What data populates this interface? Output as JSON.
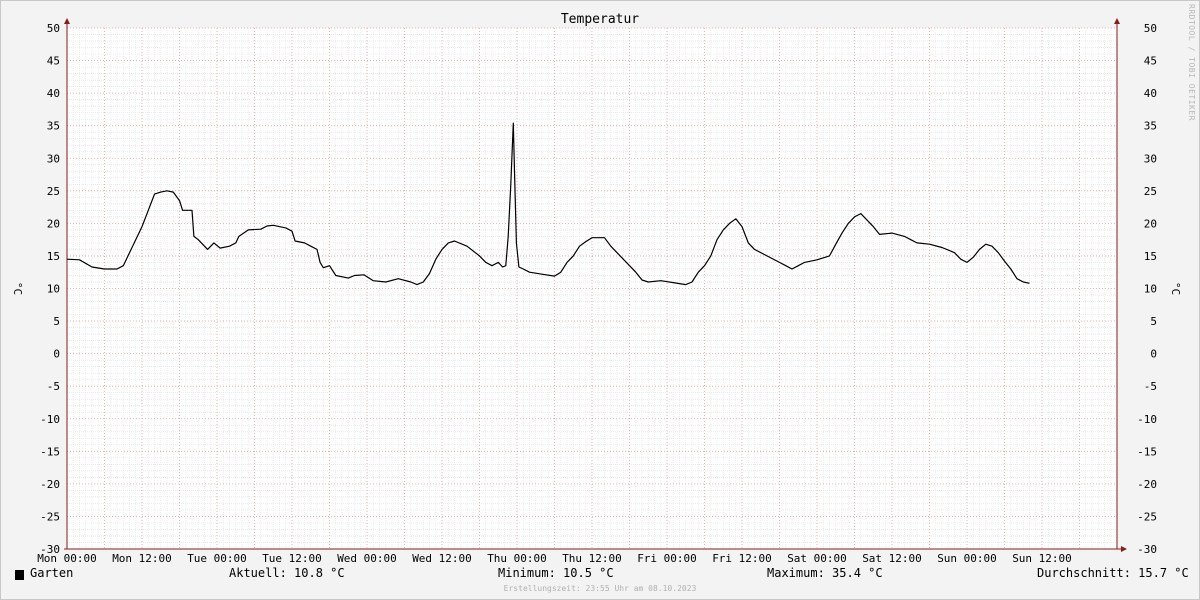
{
  "chart_data": {
    "type": "line",
    "title": "Temperatur",
    "ylabel": "°C",
    "ylabel_right": "°C",
    "ylim": [
      -30,
      50
    ],
    "y_ticks": [
      50,
      45,
      40,
      35,
      30,
      25,
      20,
      15,
      10,
      5,
      0,
      -5,
      -10,
      -15,
      -20,
      -25,
      -30
    ],
    "x_unit": "hours since Mon 00:00",
    "xlim": [
      0,
      168
    ],
    "x_tick_labels": [
      "Mon 00:00",
      "Mon 12:00",
      "Tue 00:00",
      "Tue 12:00",
      "Wed 00:00",
      "Wed 12:00",
      "Thu 00:00",
      "Thu 12:00",
      "Fri 00:00",
      "Fri 12:00",
      "Sat 00:00",
      "Sat 12:00",
      "Sun 00:00",
      "Sun 12:00"
    ],
    "x_tick_positions": [
      0,
      12,
      24,
      36,
      48,
      60,
      72,
      84,
      96,
      108,
      120,
      132,
      144,
      156
    ],
    "grid": true,
    "series": [
      {
        "name": "Garten",
        "color": "#000000",
        "points": [
          [
            0,
            14.5
          ],
          [
            2,
            14.4
          ],
          [
            4,
            13.3
          ],
          [
            6,
            13.0
          ],
          [
            8,
            13.0
          ],
          [
            9,
            13.5
          ],
          [
            10,
            15.5
          ],
          [
            12,
            19.5
          ],
          [
            13,
            22.0
          ],
          [
            14,
            24.5
          ],
          [
            15,
            24.8
          ],
          [
            16,
            25.0
          ],
          [
            17,
            24.8
          ],
          [
            18,
            23.5
          ],
          [
            18.5,
            22.0
          ],
          [
            20,
            22.0
          ],
          [
            20.3,
            18.0
          ],
          [
            21,
            17.5
          ],
          [
            22,
            16.5
          ],
          [
            22.5,
            16.0
          ],
          [
            23.5,
            17.0
          ],
          [
            24.5,
            16.2
          ],
          [
            26,
            16.5
          ],
          [
            27,
            17.0
          ],
          [
            27.5,
            18.0
          ],
          [
            29,
            19.0
          ],
          [
            31,
            19.1
          ],
          [
            32,
            19.6
          ],
          [
            33,
            19.7
          ],
          [
            35,
            19.3
          ],
          [
            36,
            18.8
          ],
          [
            36.5,
            17.3
          ],
          [
            38,
            17.0
          ],
          [
            39,
            16.5
          ],
          [
            40,
            16.0
          ],
          [
            40.5,
            14.0
          ],
          [
            41,
            13.2
          ],
          [
            42,
            13.5
          ],
          [
            43,
            12.0
          ],
          [
            45,
            11.6
          ],
          [
            46,
            12.0
          ],
          [
            47.5,
            12.1
          ],
          [
            49,
            11.2
          ],
          [
            51,
            11.0
          ],
          [
            53,
            11.5
          ],
          [
            55,
            11.0
          ],
          [
            56,
            10.6
          ],
          [
            57,
            11.0
          ],
          [
            58,
            12.3
          ],
          [
            59,
            14.5
          ],
          [
            60,
            16.0
          ],
          [
            61,
            17.0
          ],
          [
            62,
            17.3
          ],
          [
            64,
            16.5
          ],
          [
            66,
            15.0
          ],
          [
            67,
            14.0
          ],
          [
            68,
            13.5
          ],
          [
            69,
            14.0
          ],
          [
            69.7,
            13.3
          ],
          [
            70.2,
            13.5
          ],
          [
            70.6,
            18.0
          ],
          [
            71.0,
            26.0
          ],
          [
            71.4,
            35.4
          ],
          [
            71.6,
            28.0
          ],
          [
            71.9,
            17.0
          ],
          [
            72.3,
            13.3
          ],
          [
            73,
            13.0
          ],
          [
            74,
            12.5
          ],
          [
            76,
            12.2
          ],
          [
            78,
            11.9
          ],
          [
            79,
            12.5
          ],
          [
            80,
            14.0
          ],
          [
            81,
            15.0
          ],
          [
            82,
            16.5
          ],
          [
            83,
            17.2
          ],
          [
            84,
            17.8
          ],
          [
            86,
            17.8
          ],
          [
            87,
            16.5
          ],
          [
            89,
            14.5
          ],
          [
            91,
            12.5
          ],
          [
            92,
            11.3
          ],
          [
            93,
            11.0
          ],
          [
            95,
            11.2
          ],
          [
            97,
            10.9
          ],
          [
            99,
            10.6
          ],
          [
            100,
            11.0
          ],
          [
            101,
            12.5
          ],
          [
            102,
            13.5
          ],
          [
            103,
            15.0
          ],
          [
            104,
            17.5
          ],
          [
            105,
            19.0
          ],
          [
            106,
            20.0
          ],
          [
            107,
            20.7
          ],
          [
            108,
            19.5
          ],
          [
            109,
            17.0
          ],
          [
            110,
            16.0
          ],
          [
            112,
            15.0
          ],
          [
            114,
            14.0
          ],
          [
            115,
            13.5
          ],
          [
            116,
            13.0
          ],
          [
            117,
            13.5
          ],
          [
            118,
            14.0
          ],
          [
            120,
            14.4
          ],
          [
            122,
            15.0
          ],
          [
            123,
            16.8
          ],
          [
            124,
            18.5
          ],
          [
            125,
            20.0
          ],
          [
            126,
            21.0
          ],
          [
            127,
            21.5
          ],
          [
            128,
            20.5
          ],
          [
            129,
            19.5
          ],
          [
            130,
            18.3
          ],
          [
            132,
            18.5
          ],
          [
            134,
            18.0
          ],
          [
            135,
            17.5
          ],
          [
            136,
            17.0
          ],
          [
            138,
            16.8
          ],
          [
            140,
            16.3
          ],
          [
            141,
            15.9
          ],
          [
            142,
            15.5
          ],
          [
            143,
            14.5
          ],
          [
            144,
            14.0
          ],
          [
            145,
            14.8
          ],
          [
            146,
            16.0
          ],
          [
            147,
            16.8
          ],
          [
            148,
            16.5
          ],
          [
            149,
            15.5
          ],
          [
            150,
            14.2
          ],
          [
            151,
            13.0
          ],
          [
            152,
            11.5
          ],
          [
            153,
            11.0
          ],
          [
            154,
            10.8
          ]
        ]
      }
    ]
  },
  "legend": {
    "series_name": "Garten",
    "current": "Aktuell: 10.8 °C",
    "minimum": "Minimum: 10.5 °C",
    "maximum": "Maximum: 35.4 °C",
    "average": "Durchschnitt: 15.7 °C"
  },
  "footer": {
    "created": "Erstellungszeit: 23:55 Uhr am 08.10.2023",
    "watermark": "RRDTOOL / TOBI OETIKER"
  }
}
